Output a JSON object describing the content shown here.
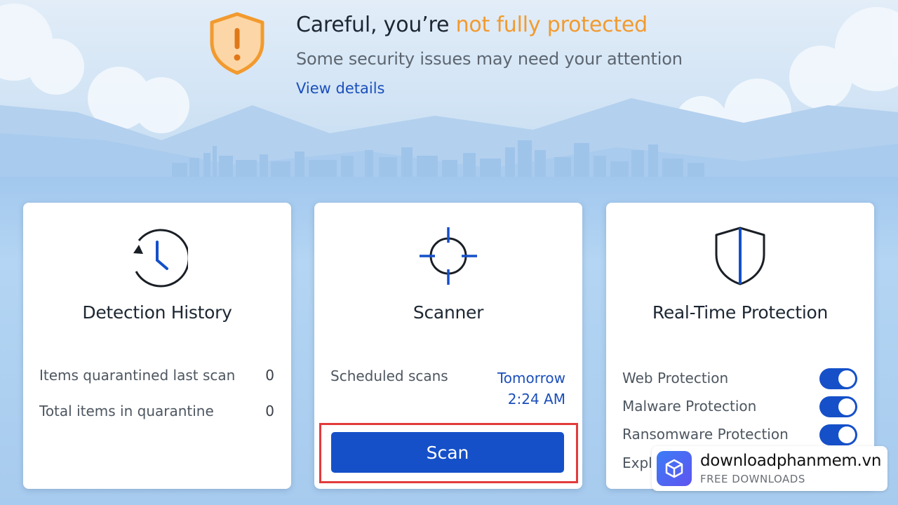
{
  "banner": {
    "title_prefix": "Careful, you’re ",
    "title_warning": "not fully protected",
    "subtitle": "Some security issues may need your attention",
    "link": "View details",
    "status_icon": "shield-exclamation-icon"
  },
  "colors": {
    "accent": "#1550c9",
    "warning": "#f29a2e",
    "link": "#1b4fbb",
    "highlight": "#e23b3b"
  },
  "detection_history": {
    "title": "Detection History",
    "icon": "history-clock-icon",
    "rows": [
      {
        "label": "Items quarantined last scan",
        "value": "0"
      },
      {
        "label": "Total items in quarantine",
        "value": "0"
      }
    ]
  },
  "scanner": {
    "title": "Scanner",
    "icon": "crosshair-icon",
    "scheduled_label": "Scheduled scans",
    "scheduled_day": "Tomorrow",
    "scheduled_time": "2:24 AM",
    "scan_button": "Scan"
  },
  "realtime": {
    "title": "Real-Time Protection",
    "icon": "shield-icon",
    "toggles": [
      {
        "label": "Web Protection",
        "on": true
      },
      {
        "label": "Malware Protection",
        "on": true
      },
      {
        "label": "Ransomware Protection",
        "on": true
      },
      {
        "label": "Exploit Protection",
        "on": true
      }
    ]
  },
  "watermark": {
    "name": "downloadphanmem.vn",
    "tagline": "FREE DOWNLOADS",
    "icon": "cube-logo-icon"
  }
}
